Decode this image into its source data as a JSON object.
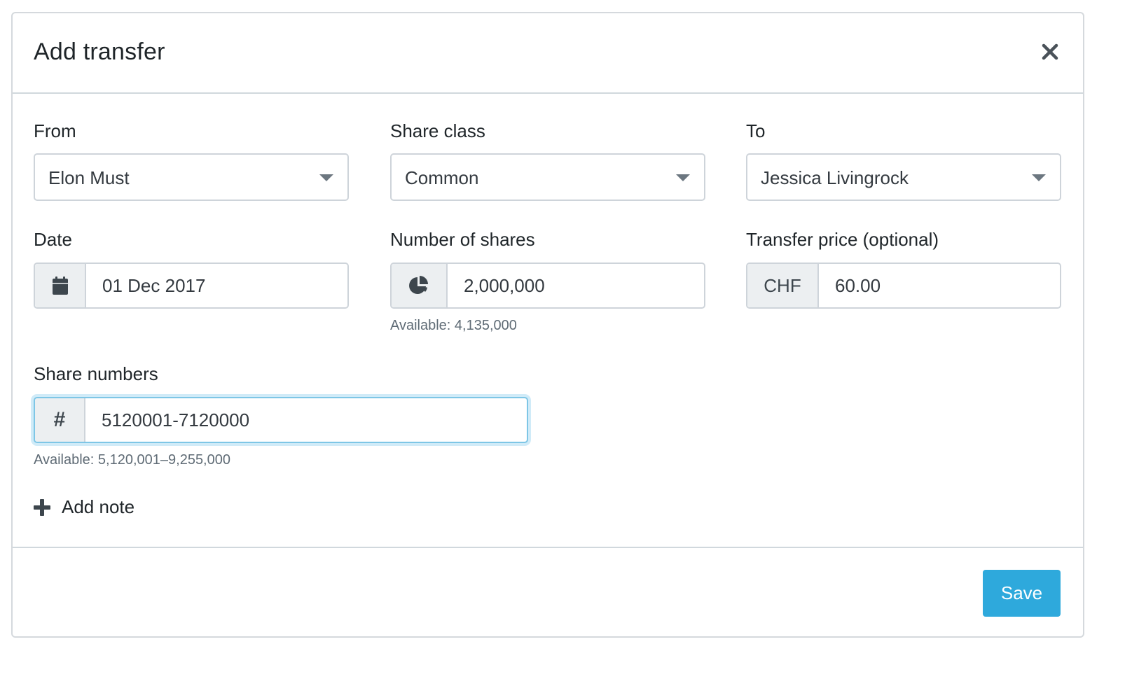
{
  "modal": {
    "title": "Add transfer"
  },
  "fields": {
    "from": {
      "label": "From",
      "value": "Elon Must"
    },
    "share_class": {
      "label": "Share class",
      "value": "Common"
    },
    "to": {
      "label": "To",
      "value": "Jessica Livingrock"
    },
    "date": {
      "label": "Date",
      "value": "01 Dec 2017",
      "icon": "calendar-icon"
    },
    "number_of_shares": {
      "label": "Number of shares",
      "value": "2,000,000",
      "icon": "pie-chart-icon",
      "helper": "Available: 4,135,000"
    },
    "transfer_price": {
      "label": "Transfer price (optional)",
      "currency": "CHF",
      "value": "60.00"
    },
    "share_numbers": {
      "label": "Share numbers",
      "prefix": "#",
      "value": "5120001-7120000",
      "helper": "Available: 5,120,001–9,255,000"
    }
  },
  "actions": {
    "add_note": "Add note",
    "save": "Save"
  },
  "colors": {
    "primary": "#2ea9dc",
    "focus_border": "#7ec6e6",
    "addon_bg": "#eceff1"
  }
}
